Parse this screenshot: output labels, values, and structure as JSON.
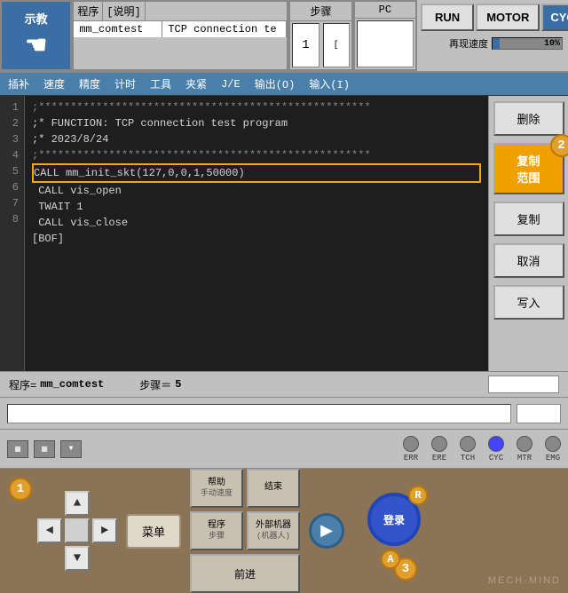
{
  "header": {
    "demo_label": "示教",
    "program_label": "程序",
    "description_label": "[说明]",
    "program_name": "mm_comtest",
    "description_value": "TCP connection te",
    "step_label": "步骤",
    "step_value": "1",
    "step_bracket": "[",
    "pc_label": "PC",
    "run_label": "RUN",
    "motor_label": "MOTOR",
    "cycle_label": "CYCLE",
    "speed_label": "再现速度",
    "speed_value": "10%"
  },
  "menu": {
    "items": [
      "插补",
      "速度",
      "精度",
      "计时",
      "工具",
      "夹紧",
      "J/E",
      "输出(O)",
      "输入(I)"
    ]
  },
  "code": {
    "lines": [
      {
        "num": "1",
        "text": ";****************************************************"
      },
      {
        "num": "2",
        "text": ";* FUNCTION: TCP connection test program"
      },
      {
        "num": "3",
        "text": ";* 2023/8/24"
      },
      {
        "num": "4",
        "text": ";****************************************************"
      },
      {
        "num": "5",
        "text": "CALL mm_init_skt(127,0,0,1,50000)",
        "highlighted": true
      },
      {
        "num": "6",
        "text": " CALL vis_open"
      },
      {
        "num": "7",
        "text": " TWAIT 1"
      },
      {
        "num": "8",
        "text": " CALL vis_close"
      },
      {
        "num": "",
        "text": "[BOF]"
      }
    ]
  },
  "sidebar": {
    "delete_label": "删除",
    "copy_range_label": "复制\n范围",
    "copy_label": "复制",
    "cancel_label": "取消",
    "write_label": "写入",
    "badge2": "2"
  },
  "status": {
    "program_label": "程序=",
    "program_value": "mm_comtest",
    "step_label": "步骤＝",
    "step_value": "5"
  },
  "indicators": {
    "err_label": "ERR",
    "ere_label": "ERE",
    "tch_label": "TCH",
    "cyc_label": "CYC",
    "mtr_label": "MTR",
    "emg_label": "EMG"
  },
  "controls": {
    "menu_label": "菜单",
    "forward_label": "前进",
    "btn1_line1": "帮助",
    "btn1_line2": "手动速度",
    "btn2_line1": "结束",
    "btn2_line2": "",
    "btn3_line1": "程序",
    "btn3_line2": "步骤",
    "btn4_line1": "外部机器",
    "btn4_line2": "(机器人)",
    "login_label": "登录",
    "badge1": "1",
    "badge3": "3",
    "badge_r": "R",
    "badge_a": "A"
  },
  "watermark": "MECH-MIND"
}
